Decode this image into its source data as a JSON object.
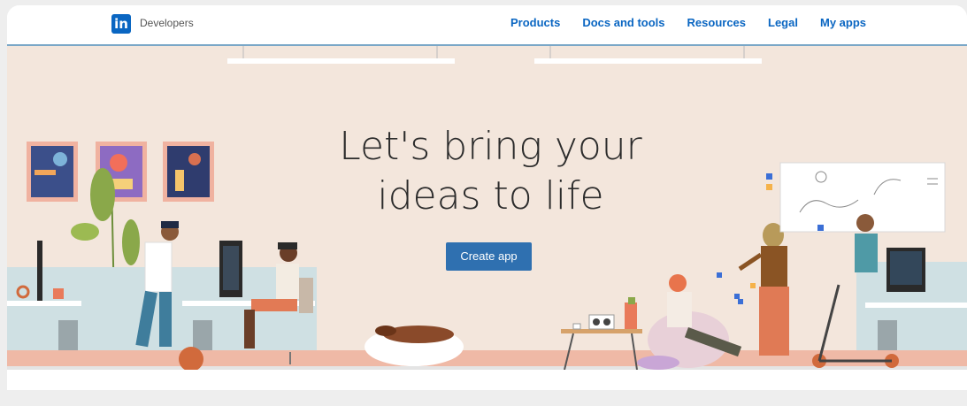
{
  "header": {
    "logo_text": "in",
    "brand": "Developers",
    "nav": [
      "Products",
      "Docs and tools",
      "Resources",
      "Legal",
      "My apps"
    ]
  },
  "hero": {
    "headline_line1": "Let's bring your",
    "headline_line2": "ideas to life",
    "cta_label": "Create app"
  },
  "colors": {
    "brand_blue": "#0a66c2",
    "cta_blue": "#2f70b0",
    "hero_background": "#f3e6dc",
    "floor": "#efb9a6"
  }
}
